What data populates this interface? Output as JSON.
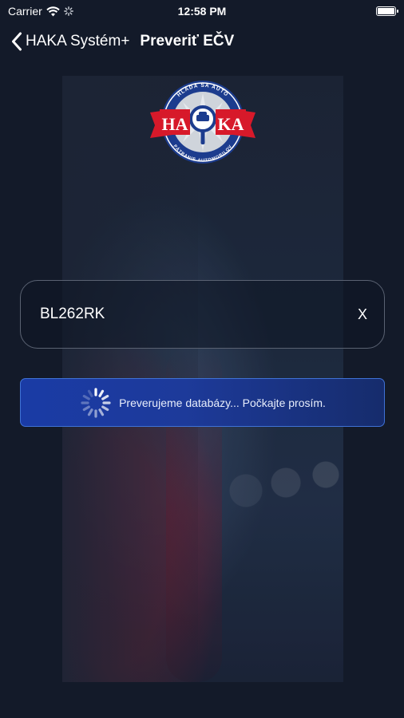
{
  "status_bar": {
    "carrier": "Carrier",
    "time": "12:58 PM"
  },
  "nav": {
    "back_label": "HAKA Systém+",
    "title": "Preveriť EČV"
  },
  "logo": {
    "left_text": "HA",
    "right_text": "KA",
    "top_arc_text": "HLADÁ SA AUTO",
    "bottom_arc_text": "PÁTRANIE AUTOMOBILOV"
  },
  "plate_input": {
    "value": "BL262RK",
    "clear_label": "X"
  },
  "loading": {
    "message": "Preverujeme databázy... Počkajte prosím."
  },
  "colors": {
    "background": "#131a29",
    "banner_blue": "#1a3ba5",
    "logo_red": "#d7192a",
    "logo_blue": "#1c3c8e"
  }
}
